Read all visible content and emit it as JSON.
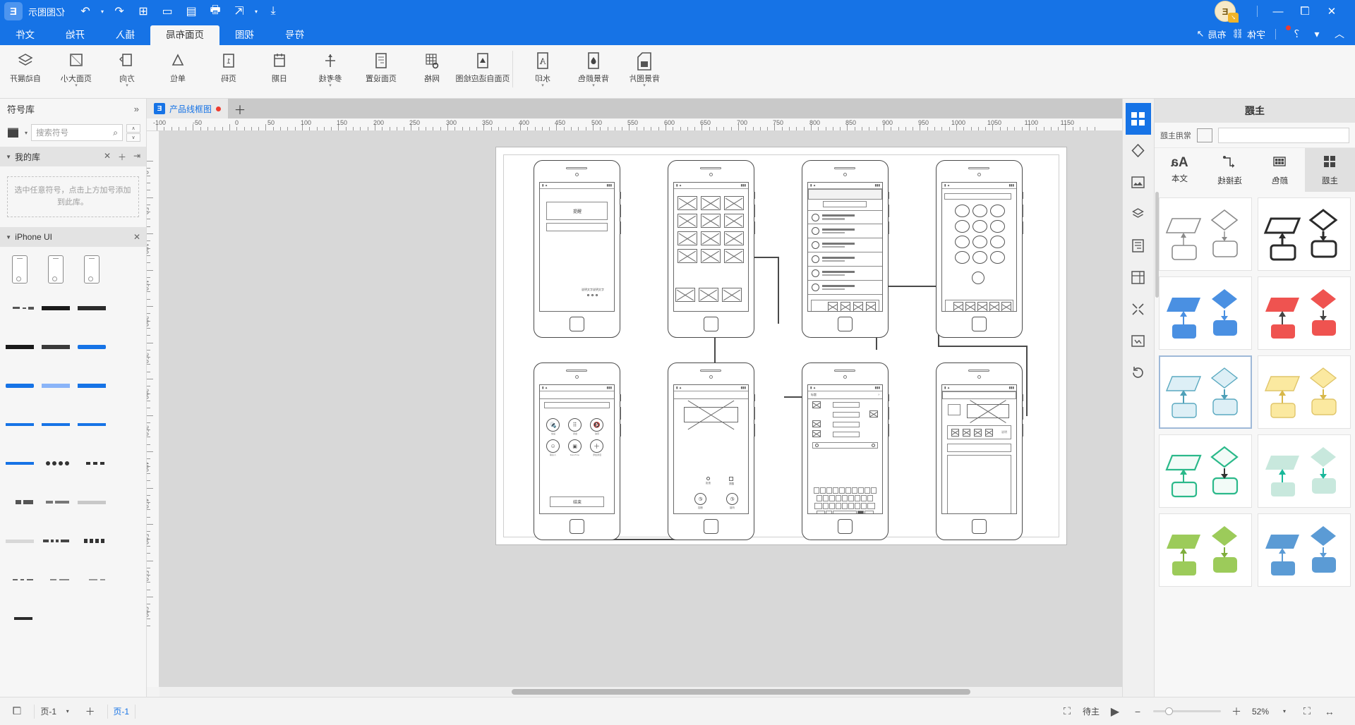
{
  "app": {
    "name": "亿图图示",
    "logo_glyph": "E",
    "avatar_initial": "E",
    "avatar_badge": "✓"
  },
  "titlebar": {
    "window_buttons": [
      "✕",
      "❐",
      "—"
    ],
    "quick_access": [
      "◠",
      "▾",
      "？",
      "|",
      "字体",
      "布局"
    ],
    "right_icons": [
      {
        "name": "export-icon",
        "glyph": "⤓"
      },
      {
        "name": "caret-down-icon",
        "glyph": "▾"
      },
      {
        "name": "share-icon",
        "glyph": "⇱"
      },
      {
        "name": "print-icon",
        "glyph": "🖶"
      },
      {
        "name": "save-icon",
        "glyph": "▤"
      },
      {
        "name": "open-icon",
        "glyph": "▭"
      },
      {
        "name": "new-icon",
        "glyph": "⊞"
      },
      {
        "name": "undo-icon",
        "glyph": "↶"
      },
      {
        "name": "redo-caret-icon",
        "glyph": "▾"
      },
      {
        "name": "redo-icon",
        "glyph": "↷"
      }
    ]
  },
  "menubar": {
    "icons": [
      {
        "name": "collapse-ribbon-icon",
        "glyph": "︿"
      },
      {
        "name": "notification-icon",
        "glyph": "？"
      },
      {
        "name": "caret-icon",
        "glyph": "▾"
      }
    ],
    "items": [
      {
        "name": "font-tool",
        "label": "字体",
        "glyph": "⛓"
      },
      {
        "name": "layout-tool",
        "label": "布局",
        "glyph": "↗"
      }
    ]
  },
  "ribbon_tabs": [
    {
      "id": "file",
      "label": "文件",
      "active": false
    },
    {
      "id": "home",
      "label": "开始",
      "active": false
    },
    {
      "id": "insert",
      "label": "插入",
      "active": false
    },
    {
      "id": "page-layout",
      "label": "页面布局",
      "active": true
    },
    {
      "id": "view",
      "label": "视图",
      "active": false
    },
    {
      "id": "symbol",
      "label": "符号",
      "active": false
    }
  ],
  "ribbon": {
    "groups": [
      {
        "items": [
          {
            "name": "auto-layout",
            "label": "自动展开",
            "icon": "layers-icon",
            "caret": false
          },
          {
            "name": "page-size",
            "label": "页面大小",
            "icon": "page-size-icon",
            "caret": true
          },
          {
            "name": "orientation",
            "label": "方向",
            "icon": "orientation-icon",
            "caret": true
          },
          {
            "name": "unit",
            "label": "单位",
            "icon": "unit-icon",
            "caret": true
          },
          {
            "name": "page-number",
            "label": "页码",
            "icon": "page-number-icon",
            "caret": true
          },
          {
            "name": "date",
            "label": "日期",
            "icon": "date-icon",
            "caret": true
          },
          {
            "name": "smart-guides",
            "label": "参考线",
            "icon": "guides-icon",
            "caret": true
          },
          {
            "name": "page-setup",
            "label": "页面设置",
            "icon": "page-setup-icon",
            "caret": false
          },
          {
            "name": "grid",
            "label": "网格",
            "icon": "grid-icon",
            "caret": false
          },
          {
            "name": "page-fit",
            "label": "页面自适应绘图",
            "icon": "fit-icon",
            "caret": false
          }
        ]
      },
      {
        "items": [
          {
            "name": "watermark",
            "label": "水印",
            "icon": "watermark-icon",
            "caret": true
          },
          {
            "name": "background-color",
            "label": "背景颜色",
            "icon": "bgcolor-icon",
            "caret": true
          },
          {
            "name": "background-image",
            "label": "背景图片",
            "icon": "bgimage-icon",
            "caret": true
          }
        ]
      }
    ]
  },
  "left_panel": {
    "title": "主题",
    "search_label": "常用主题",
    "tabs": [
      {
        "name": "theme",
        "label": "主题",
        "icon": "grid4-icon",
        "selected": true
      },
      {
        "name": "color",
        "label": "颜色",
        "icon": "palette-icon",
        "selected": false
      },
      {
        "name": "connector",
        "label": "连接线",
        "icon": "connector-icon",
        "selected": false
      },
      {
        "name": "text",
        "label": "文本",
        "icon": "Aa",
        "selected": false
      }
    ],
    "theme_cells": [
      {
        "name": "theme-mono-dark",
        "selected": false,
        "fill": "#ffffff",
        "stroke": "#2b2b2b",
        "arrow": "#2b2b2b"
      },
      {
        "name": "theme-mono-light",
        "selected": false,
        "fill": "#ffffff",
        "stroke": "#8a8a8a",
        "arrow": "#8a8a8a"
      },
      {
        "name": "theme-red",
        "selected": false,
        "fill": "#ef5350",
        "stroke": "#ef5350",
        "arrow": "#444444"
      },
      {
        "name": "theme-blue",
        "selected": false,
        "fill": "#4a90e2",
        "stroke": "#4a90e2",
        "arrow": "#4a90e2"
      },
      {
        "name": "theme-yellow",
        "selected": false,
        "fill": "#fbe9a0",
        "stroke": "#e0c56a",
        "arrow": "#d8b84a"
      },
      {
        "name": "theme-cyan",
        "selected": true,
        "fill": "#d5eef5",
        "stroke": "#5aa9c0",
        "arrow": "#4fa0b8"
      },
      {
        "name": "theme-mint",
        "selected": false,
        "fill": "#c8e8dd",
        "stroke": "#c8e8dd",
        "arrow": "#19b89a"
      },
      {
        "name": "theme-green",
        "selected": false,
        "fill": "#f2fbf7",
        "stroke": "#2bb98a",
        "arrow": "#2bb98a"
      },
      {
        "name": "theme-steel",
        "selected": false,
        "fill": "#5b9bd5",
        "stroke": "#5b9bd5",
        "arrow": "#5b9bd5"
      },
      {
        "name": "theme-olive",
        "selected": false,
        "fill": "#9ccb5a",
        "stroke": "#9ccb5a",
        "arrow": "#7fae3c"
      }
    ]
  },
  "rail": [
    {
      "name": "rail-shapes",
      "glyph": "▦",
      "selected": true
    },
    {
      "name": "rail-diamond",
      "glyph": "◈",
      "selected": false
    },
    {
      "name": "rail-image",
      "glyph": "🖼",
      "selected": false
    },
    {
      "name": "rail-layers",
      "glyph": "◳",
      "selected": false
    },
    {
      "name": "rail-notes",
      "glyph": "▤",
      "selected": false
    },
    {
      "name": "rail-container",
      "glyph": "⊞",
      "selected": false
    },
    {
      "name": "rail-align",
      "glyph": "⤧",
      "selected": false
    },
    {
      "name": "rail-frame",
      "glyph": "⛶",
      "selected": false
    },
    {
      "name": "rail-refresh",
      "glyph": "⟳",
      "selected": false
    }
  ],
  "doc_tab": {
    "label": "产品线框图",
    "modified_dot": true,
    "icon_glyph": "E",
    "add_tab_glyph": "＋"
  },
  "rulers": {
    "h_labels": [
      "-100",
      "-50",
      "0",
      "50",
      "100",
      "150",
      "200",
      "250",
      "300",
      "350",
      "400",
      "450",
      "500",
      "550",
      "600",
      "650",
      "700",
      "750",
      "800",
      "850"
    ],
    "v_labels": [
      "0",
      "20",
      "100",
      "120",
      "200",
      "220",
      "300",
      "320",
      "400",
      "420",
      "500",
      "520"
    ]
  },
  "right_panel": {
    "title": "符号库",
    "collapse_glyph": "»",
    "search_placeholder": "搜索符号",
    "library_icon": "library-icon",
    "sections": [
      {
        "name": "my-library",
        "title": "我的库",
        "actions": [
          "⇥",
          "＋",
          "✕"
        ],
        "empty_hint": "选中任意符号，点击上方加号添加到此库。"
      },
      {
        "name": "iphone-ui",
        "title": "iPhone UI",
        "actions": [
          "✕"
        ],
        "empty_hint": ""
      }
    ]
  },
  "statusbar": {
    "left_icons": [
      {
        "name": "fit-width-icon",
        "glyph": "↔"
      },
      {
        "name": "fit-page-icon",
        "glyph": "⛶"
      },
      {
        "name": "zoom-caret-icon",
        "glyph": "▾"
      }
    ],
    "zoom_level": "52%",
    "zoom_out_glyph": "＋",
    "zoom_in_glyph": "−",
    "presentation_glyph": "◀",
    "presentation_label": "待主",
    "select_all_glyph": "⛶",
    "page_label": "页-1",
    "page_label2": "页-1",
    "add_page_glyph": "＋",
    "page_caret_glyph": "▾",
    "view_mode_glyph": "❐"
  },
  "palette": {
    "colors": [
      "#ffffff",
      "#f2f2f2",
      "#e0e0e0",
      "#cfcfcf",
      "#bdbdbd",
      "#9e9e9e",
      "#757575",
      "#5d5d5d",
      "#424242",
      "#212121",
      "#000000",
      "#e8dcc8",
      "#dcc9a8",
      "#c9a87c",
      "#b08a5a",
      "#e0603c",
      "#d8472a",
      "#c03a20",
      "#8e2a16",
      "#f0884a",
      "#e8702a",
      "#31c5c7",
      "#1fa8ad",
      "#168a90",
      "#0f6d73",
      "#0a5156",
      "#17a2b8",
      "#0d8a9e",
      "#3fc1c9",
      "#00bcd4",
      "#0097a7",
      "#2f6fd0",
      "#2a5fb8",
      "#1f4a9a",
      "#15377a",
      "#0e2a5e",
      "#3b82f6",
      "#2563eb",
      "#1d4ed8",
      "#1e40af",
      "#1e3a8a",
      "#7b3fa0",
      "#6a2f8e",
      "#5a2478",
      "#4a1c62",
      "#3a144e",
      "#9c27b0",
      "#8e24aa",
      "#7b1fa2",
      "#6a1b9a",
      "#4a148c",
      "#c2185b",
      "#ad1457",
      "#880e4f",
      "#e91e63",
      "#f06292",
      "#9ccb3c",
      "#8bc34a",
      "#7cb342",
      "#689f38",
      "#558b2f",
      "#fdd835",
      "#fbc02d",
      "#f9a825",
      "#f57f17",
      "#ffb300",
      "#ff8f00",
      "#ef6c00",
      "#e65100",
      "#ff7043",
      "#f4511e",
      "#ec407a",
      "#e53935",
      "#d81b60",
      "#c2185b",
      "#f06292",
      "#ffcdd2",
      "#ef9a9a",
      "#e57373",
      "#ef5350",
      "#f44336"
    ],
    "more_glyph": "✎"
  },
  "canvas": {
    "phones_row1": [
      {
        "name": "phone-keypad",
        "screen": "keypad"
      },
      {
        "name": "phone-contact-list",
        "screen": "list"
      },
      {
        "name": "phone-photo-grid",
        "screen": "grid"
      },
      {
        "name": "phone-alert",
        "screen": "alert",
        "alert_text": "提醒"
      }
    ],
    "phones_row2": [
      {
        "name": "phone-media",
        "screen": "media"
      },
      {
        "name": "phone-keyboard",
        "screen": "keyboard"
      },
      {
        "name": "phone-call",
        "screen": "call"
      },
      {
        "name": "phone-incall",
        "screen": "incall",
        "end_label": "结束"
      }
    ]
  }
}
